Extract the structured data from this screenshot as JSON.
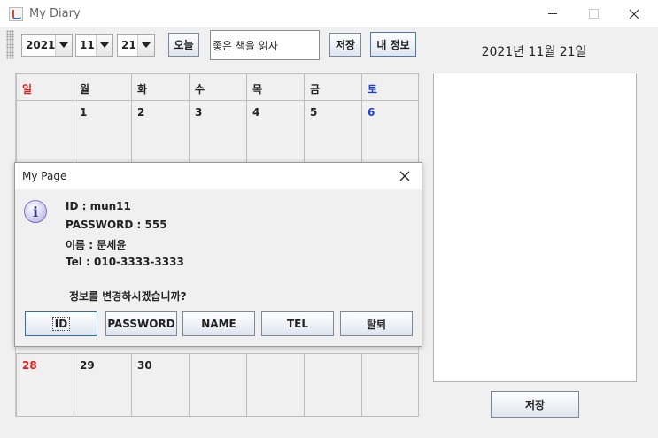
{
  "window": {
    "title": "My Diary"
  },
  "toolbar": {
    "year": "2021",
    "month": "11",
    "day": "21",
    "today_label": "오늘",
    "memo_title": "좋은 책을 읽자",
    "save_label": "저장",
    "myinfo_label": "내 정보"
  },
  "calendar": {
    "weekdays": [
      "일",
      "월",
      "화",
      "수",
      "목",
      "금",
      "토"
    ],
    "week1": [
      "",
      "1",
      "2",
      "3",
      "4",
      "5",
      "6"
    ],
    "last_week": [
      "28",
      "29",
      "30",
      "",
      "",
      "",
      ""
    ]
  },
  "side": {
    "selected_date": "2021년 11월 21일",
    "save_label": "저장"
  },
  "dialog": {
    "title": "My Page",
    "lines": [
      "ID : mun11",
      "PASSWORD : 555",
      "이름 : 문세윤",
      "Tel : 010-3333-3333"
    ],
    "question": "정보를 변경하시겠습니까?",
    "buttons": [
      "ID",
      "PASSWORD",
      "NAME",
      "TEL",
      "탈퇴"
    ]
  },
  "colors": {
    "sunday": "#e02020",
    "saturday": "#1b3fd6",
    "info_icon": "#c9c4ee"
  }
}
